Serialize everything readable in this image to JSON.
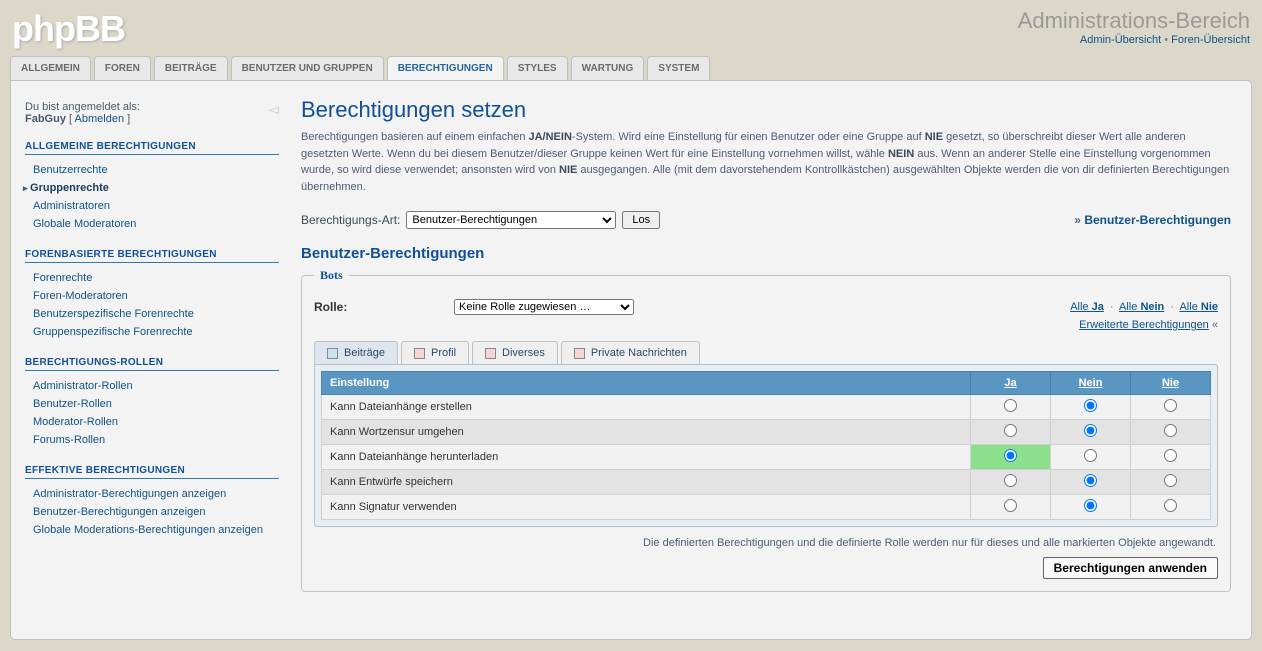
{
  "header": {
    "logo_text": "phpBB",
    "admin_area": "Administrations-Bereich",
    "link_admin_overview": "Admin-Übersicht",
    "link_forum_overview": "Foren-Übersicht",
    "separator": " • "
  },
  "tabs": [
    "ALLGEMEIN",
    "FOREN",
    "BEITRÄGE",
    "BENUTZER UND GRUPPEN",
    "BERECHTIGUNGEN",
    "STYLES",
    "WARTUNG",
    "SYSTEM"
  ],
  "active_tab_index": 4,
  "login": {
    "prefix": "Du bist angemeldet als:",
    "user": "FabGuy",
    "logout": "Abmelden"
  },
  "sidebar": {
    "sections": [
      {
        "title": "ALLGEMEINE BERECHTIGUNGEN",
        "items": [
          "Benutzerrechte",
          "Gruppenrechte",
          "Administratoren",
          "Globale Moderatoren"
        ],
        "current_index": 1
      },
      {
        "title": "FORENBASIERTE BERECHTIGUNGEN",
        "items": [
          "Forenrechte",
          "Foren-Moderatoren",
          "Benutzerspezifische Forenrechte",
          "Gruppenspezifische Forenrechte"
        ],
        "current_index": -1
      },
      {
        "title": "BERECHTIGUNGS-ROLLEN",
        "items": [
          "Administrator-Rollen",
          "Benutzer-Rollen",
          "Moderator-Rollen",
          "Forums-Rollen"
        ],
        "current_index": -1
      },
      {
        "title": "EFFEKTIVE BERECHTIGUNGEN",
        "items": [
          "Administrator-Berechtigungen anzeigen",
          "Benutzer-Berechtigungen anzeigen",
          "Globale Moderations-Berechtigungen anzeigen"
        ],
        "current_index": -1
      }
    ]
  },
  "main": {
    "h1": "Berechtigungen setzen",
    "intro_parts": {
      "a": "Berechtigungen basieren auf einem einfachen ",
      "b": "JA/NEIN",
      "c": "-System. Wird eine Einstellung für einen Benutzer oder eine Gruppe auf ",
      "d": "NIE",
      "e": " gesetzt, so überschreibt dieser Wert alle anderen gesetzten Werte. Wenn du bei diesem Benutzer/dieser Gruppe keinen Wert für eine Einstellung vornehmen willst, wähle ",
      "f": "NEIN",
      "g": " aus. Wenn an anderer Stelle eine Einstellung vorgenommen wurde, so wird diese verwendet; ansonsten wird von ",
      "h": "NIE",
      "i": " ausgegangen. Alle (mit dem davorstehendem Kontrollkästchen) ausgewählten Objekte werden die von dir definierten Berechtigungen übernehmen."
    },
    "type_label": "Berechtigungs-Art:",
    "type_options": [
      "Benutzer-Berechtigungen"
    ],
    "go_button": "Los",
    "breadcrumb_prefix": "» ",
    "breadcrumb_link": "Benutzer-Berechtigungen",
    "h2": "Benutzer-Berechtigungen"
  },
  "perm_box": {
    "legend": "Bots",
    "role_label": "Rolle:",
    "role_value": "Keine Rolle zugewiesen …",
    "quick": {
      "all": "Alle",
      "yes": "Ja",
      "no": "Nein",
      "never": "Nie"
    },
    "advanced": "Erweiterte Berechtigungen",
    "subtabs": [
      "Beiträge",
      "Profil",
      "Diverses",
      "Private Nachrichten"
    ],
    "active_subtab_index": 0,
    "th_setting": "Einstellung",
    "th_yes": "Ja",
    "th_no": "Nein",
    "th_never": "Nie",
    "rows": [
      {
        "label": "Kann Dateianhänge erstellen",
        "sel": "no"
      },
      {
        "label": "Kann Wortzensur umgehen",
        "sel": "no"
      },
      {
        "label": "Kann Dateianhänge herunterladen",
        "sel": "yes"
      },
      {
        "label": "Kann Entwürfe speichern",
        "sel": "no"
      },
      {
        "label": "Kann Signatur verwenden",
        "sel": "no"
      }
    ],
    "footer_note": "Die definierten Berechtigungen und die definierte Rolle werden nur für dieses und alle markierten Objekte angewandt.",
    "apply_button": "Berechtigungen anwenden"
  }
}
